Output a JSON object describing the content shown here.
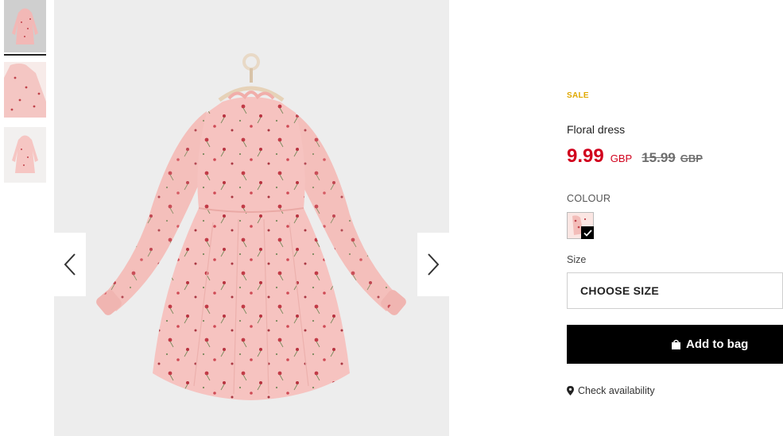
{
  "gallery": {
    "thumbnails": [
      {
        "name": "thumbnail-front",
        "selected": true
      },
      {
        "name": "thumbnail-detail",
        "selected": false
      },
      {
        "name": "thumbnail-back",
        "selected": false
      }
    ],
    "prev_icon": "chevron-left-icon",
    "next_icon": "chevron-right-icon"
  },
  "product": {
    "badge": "SALE",
    "name": "Floral dress",
    "price": "9.99",
    "currency": "GBP",
    "old_price": "15.99",
    "old_currency": "GBP"
  },
  "colour": {
    "label": "COLOUR",
    "selected_icon": "check-icon"
  },
  "size": {
    "label": "Size",
    "placeholder": "CHOOSE SIZE"
  },
  "actions": {
    "add_to_bag": "Add to bag",
    "add_icon": "shopping-bag-icon",
    "check_availability": "Check availability",
    "availability_icon": "map-pin-icon"
  },
  "colors": {
    "sale": "#e0a800",
    "price": "#d1001c",
    "button_bg": "#000000",
    "dress": "#f6c3c0"
  }
}
